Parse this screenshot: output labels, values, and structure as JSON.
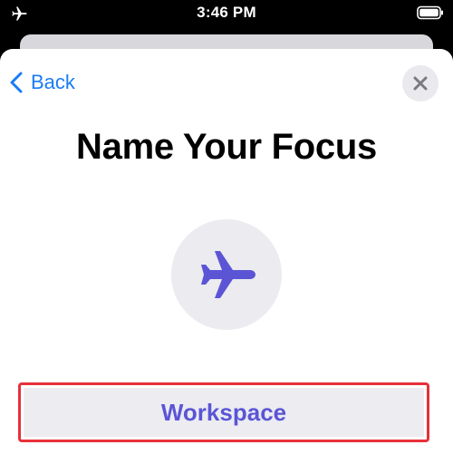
{
  "status_bar": {
    "time": "3:46 PM",
    "airplane_icon": "airplane-icon",
    "battery_icon": "battery-icon"
  },
  "sheet": {
    "back_label": "Back",
    "close_icon": "close-icon",
    "title": "Name Your Focus",
    "focus_icon": "airplane-icon",
    "focus_icon_color": "#5b55d6",
    "name_value": "Workspace",
    "accent_color": "#1a7cf5",
    "highlight_color": "#e8303a"
  }
}
